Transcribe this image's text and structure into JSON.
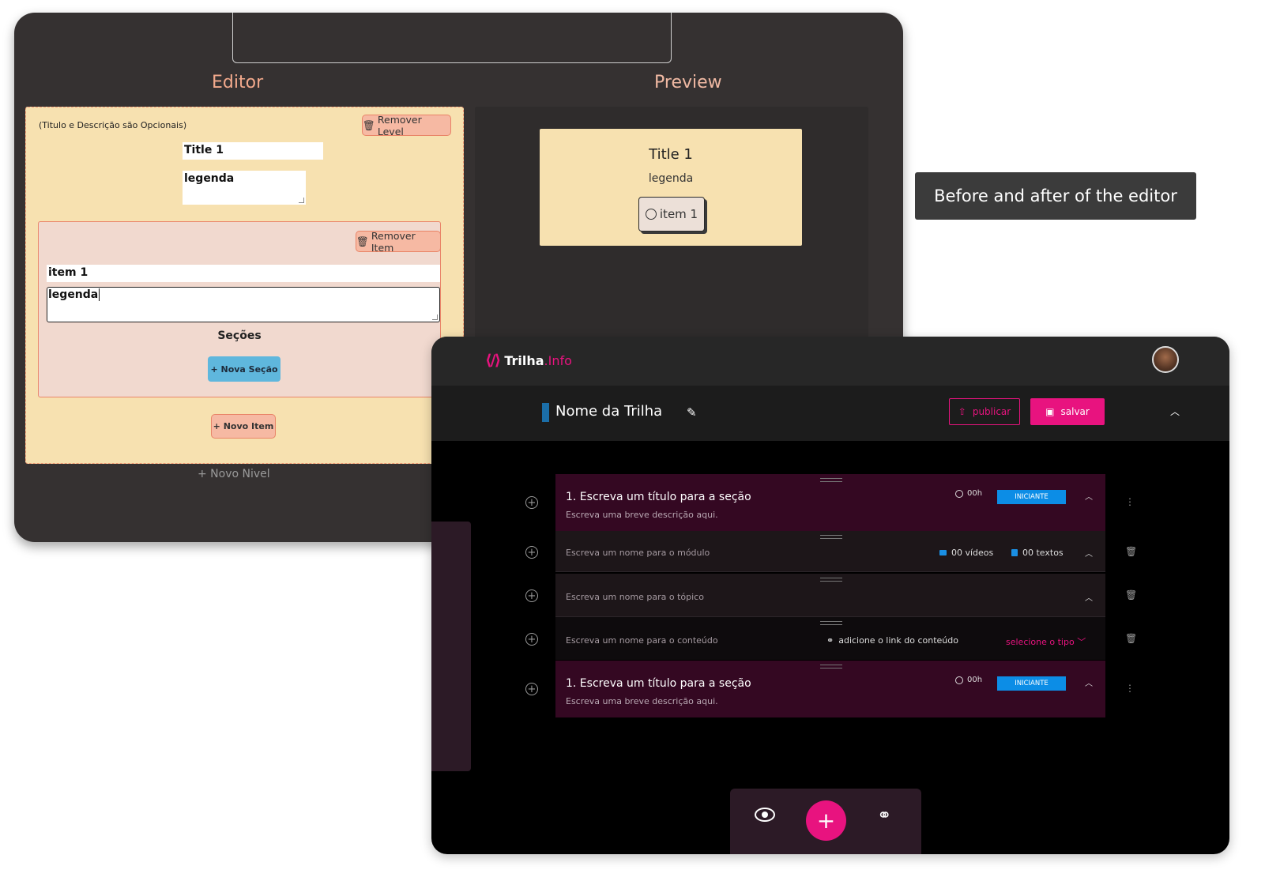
{
  "old_editor": {
    "editor_heading": "Editor",
    "preview_heading": "Preview",
    "optional_note": "(Titulo e Descrição são Opcionais)",
    "remove_level_label": "Remover Level",
    "level_title_value": "Title 1",
    "level_legend_value": "legenda",
    "remove_item_label": "Remover Item",
    "item_title_value": "item 1",
    "item_legend_value": "legenda",
    "secoes_label": "Seções",
    "nova_secao_label": "+ Nova Seção",
    "novo_item_label": "+ Novo Item",
    "novo_nivel_label": "+ Novo Nivel",
    "preview": {
      "title": "Title 1",
      "legend": "legenda",
      "item_label": "item 1"
    }
  },
  "caption": "Before and after of the editor",
  "new_editor": {
    "logo_text": "Trilha",
    "logo_accent": ".Info",
    "trail_name": "Nome da Trilha",
    "publish_label": "publicar",
    "save_label": "salvar",
    "rows": {
      "section1": {
        "title": "1. Escreva um título para a seção",
        "description": "Escreva uma breve descrição aqui.",
        "duration": "00h",
        "level": "INICIANTE"
      },
      "module": {
        "label": "Escreva um nome para o módulo",
        "videos": "00 vídeos",
        "texts": "00 textos"
      },
      "topic": {
        "label": "Escreva um nome para o tópico"
      },
      "content": {
        "label": "Escreva um nome para o conteúdo",
        "link_label": "adicione o link do conteúdo",
        "type_select": "selecione o tipo"
      },
      "section2": {
        "title": "1. Escreva um título para a seção",
        "description": "Escreva uma breve descrição aqui.",
        "duration": "00h",
        "level": "INICIANTE"
      }
    }
  },
  "colors": {
    "accent": "#e8137f",
    "badge_blue": "#0c8de6",
    "old_card": "#f7e1b0",
    "old_orange": "#e9856a"
  }
}
